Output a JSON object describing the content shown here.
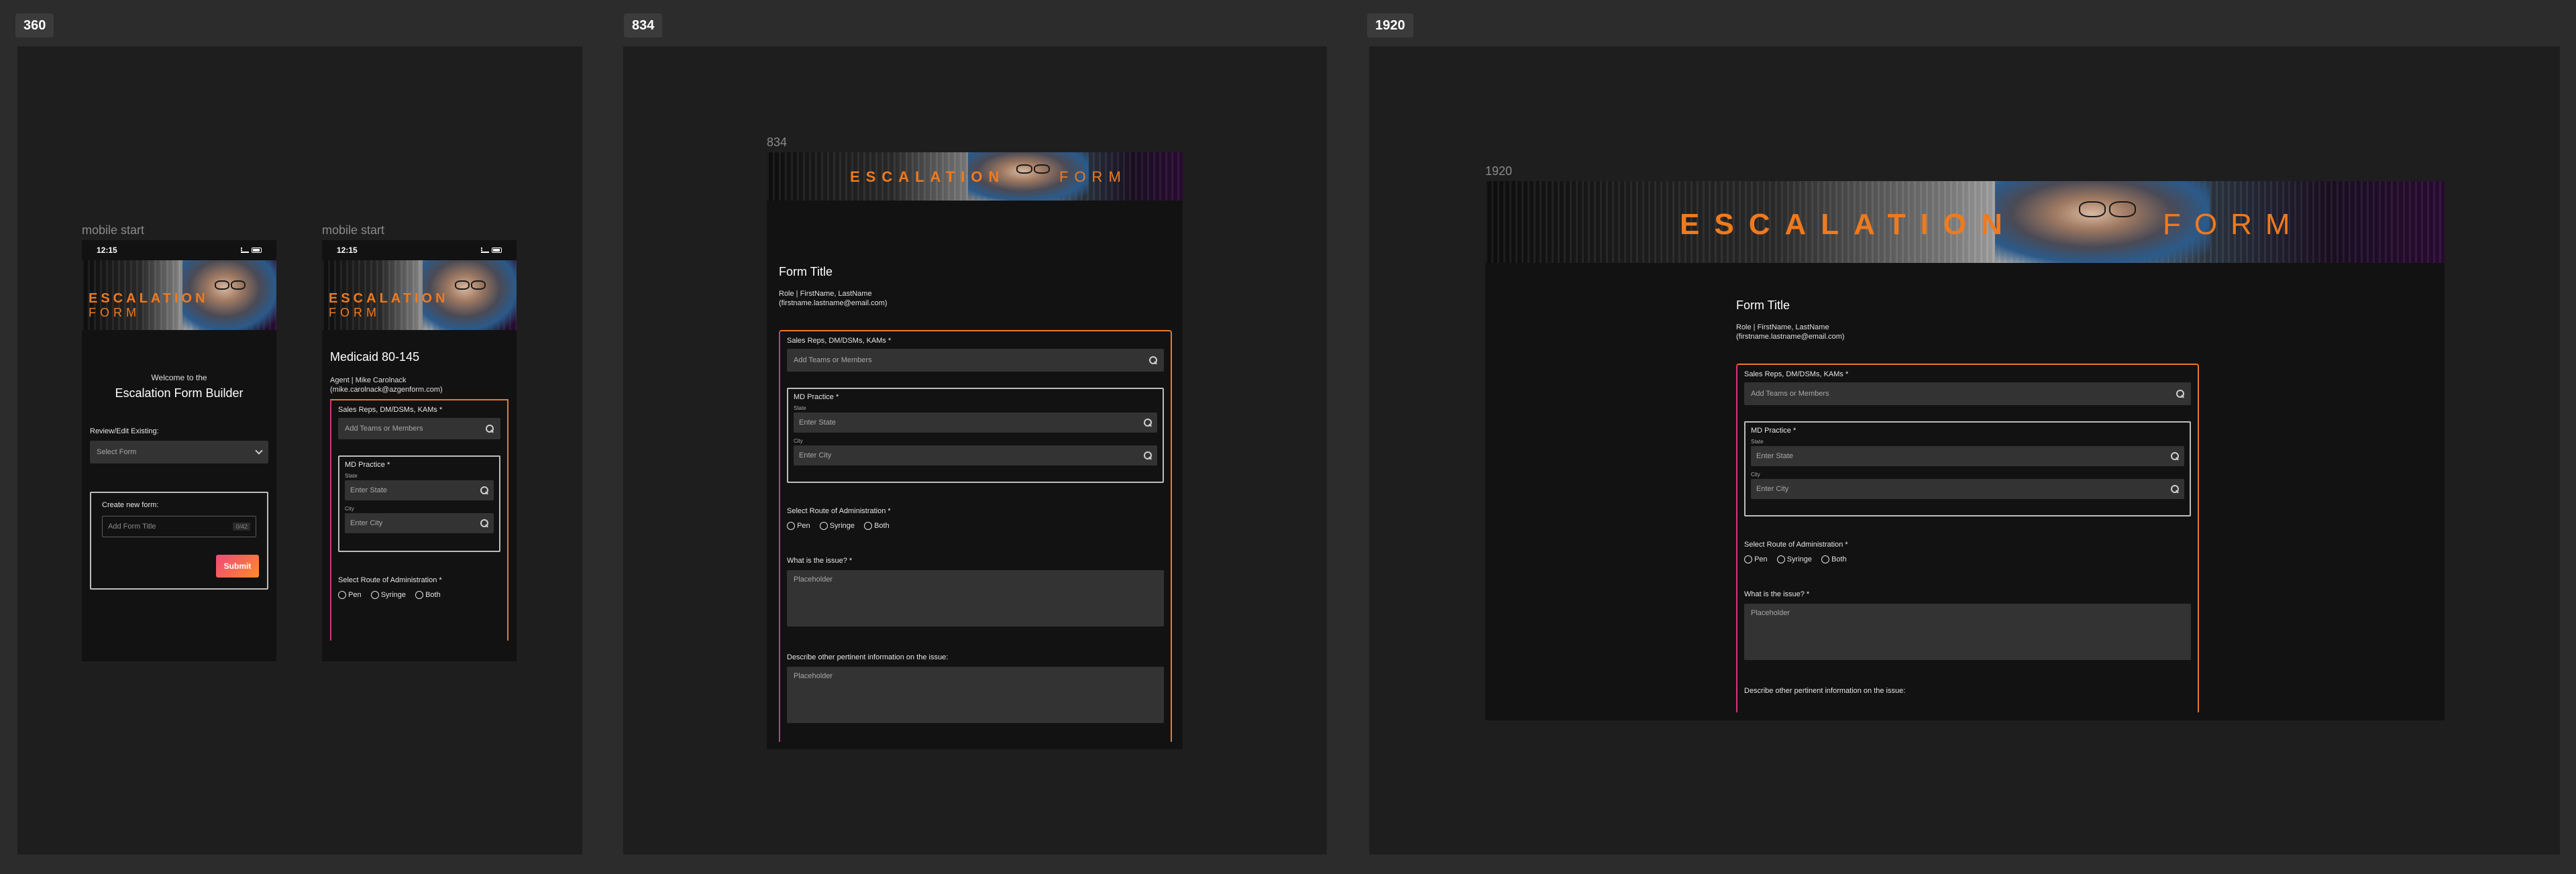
{
  "sections": {
    "s360": {
      "tag": "360"
    },
    "s834": {
      "tag": "834"
    },
    "s1920": {
      "tag": "1920"
    }
  },
  "frames": {
    "mobile1_label": "mobile start",
    "mobile2_label": "mobile start",
    "tablet_label": "834",
    "desktop_label": "1920"
  },
  "status": {
    "time": "12:15"
  },
  "banner": {
    "word1": "ESCALATION",
    "word2": "FORM"
  },
  "mobile1": {
    "welcome": "Welcome to the",
    "title": "Escalation Form Builder",
    "review_label": "Review/Edit Existing:",
    "select_value": "Select Form",
    "create_label": "Create new form:",
    "title_placeholder": "Add Form Title",
    "char_count": "0/42",
    "submit": "Submit"
  },
  "mobile2": {
    "heading": "Medicaid 80-145",
    "agent_line1": "Agent | Mike Carolnack",
    "agent_line2": "(mike.carolnack@azgenform.com)"
  },
  "form": {
    "title": "Form Title",
    "role_line1": "Role | FirstName, LastName",
    "role_line2": "(firstname.lastname@email.com)",
    "reps_label": "Sales Reps, DM/DSMs, KAMs *",
    "reps_placeholder": "Add Teams or Members",
    "md_label": "MD Practice *",
    "state_label": "State",
    "state_placeholder": "Enter State",
    "city_label": "City",
    "city_placeholder": "Enter City",
    "route_label": "Select Route of Administration *",
    "route_options": [
      "Pen",
      "Syringe",
      "Both"
    ],
    "issue_label": "What is the issue? *",
    "issue_placeholder": "Placeholder",
    "other_label": "Describe other pertinent information on the issue:",
    "other_placeholder": "Placeholder"
  },
  "colors": {
    "accent_orange": "#f07a1e",
    "border_orange": "#e87a28",
    "border_pink": "#d5357c",
    "submit_start": "#f0487a",
    "submit_end": "#ff8a2a",
    "canvas": "#2c2c2c",
    "section_bg": "#1e1e1e",
    "app_bg": "#121212",
    "input_bg": "#333333"
  },
  "icons": [
    "search-icon",
    "chevron-down-icon",
    "signal-icon",
    "battery-icon"
  ]
}
